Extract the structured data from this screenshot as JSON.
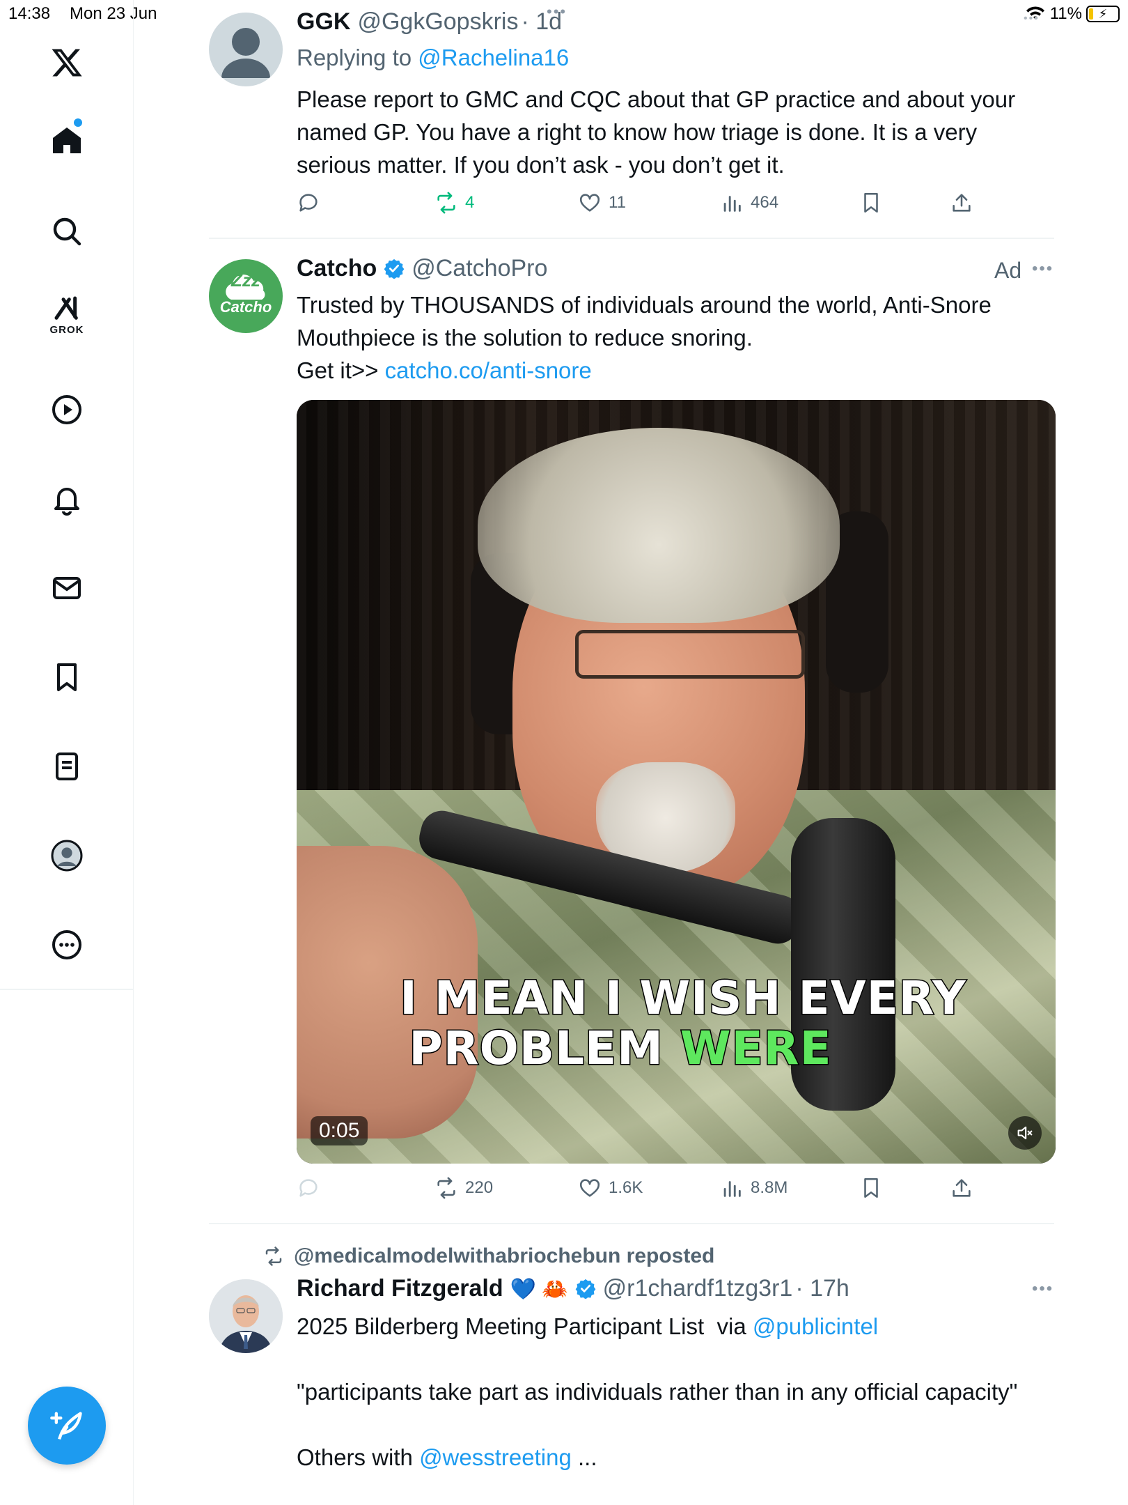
{
  "status_bar": {
    "time": "14:38",
    "date": "Mon 23 Jun",
    "battery": "11%"
  },
  "sidebar": {
    "items": [
      {
        "icon": "x-logo-icon"
      },
      {
        "icon": "home-icon",
        "has_notification_dot": true
      },
      {
        "icon": "search-icon"
      },
      {
        "icon": "grok-icon",
        "label": "GROK"
      },
      {
        "icon": "video-icon"
      },
      {
        "icon": "notifications-icon"
      },
      {
        "icon": "messages-icon"
      },
      {
        "icon": "bookmarks-icon"
      },
      {
        "icon": "lists-icon"
      },
      {
        "icon": "profile-icon"
      },
      {
        "icon": "more-icon"
      }
    ],
    "compose_icon": "compose-post-icon"
  },
  "tweets": [
    {
      "name": "GGK",
      "handle": "@GgkGopskris",
      "time": "· 1d",
      "replying_prefix": "Replying to ",
      "replying_to": "@Rachelina16",
      "text": "Please report to GMC and CQC about that GP practice and about your named GP. You have a right to know how triage is done. It is a very serious matter. If you don’t ask - you don’t get it.",
      "stats": {
        "replies": "",
        "reposts": "4",
        "likes": "11",
        "views": "464"
      },
      "reposted_by_me": true
    },
    {
      "name": "Catcho",
      "verified": true,
      "handle": "@CatchoPro",
      "ad_label": "Ad",
      "avatar_text_top": "Zzz",
      "avatar_text_bottom": "Catcho",
      "text_line1": "Trusted by THOUSANDS of individuals around the world, Anti-Snore Mouthpiece is the solution to reduce snoring.",
      "text_prefix": "Get it>> ",
      "link": "catcho.co/anti-snore",
      "video": {
        "caption_line1": "I MEAN I WISH EVERY",
        "caption_line2_white": "PROBLEM ",
        "caption_line2_green": "WERE",
        "timer": "0:05"
      },
      "stats": {
        "replies": "",
        "reposts": "220",
        "likes": "1.6K",
        "views": "8.8M"
      }
    },
    {
      "reposted_by": "@medicalmodelwithabriochebun reposted",
      "name": "Richard Fitzgerald",
      "name_emojis": "💙 🦀",
      "verified": true,
      "handle": "@r1chardf1tzg3r1",
      "time": "· 17h",
      "line1_text": "2025 Bilderberg Meeting Participant List  via ",
      "line1_link": "@publicintel",
      "quote": "\"participants take part as individuals rather than in any official capacity\"",
      "line3_text": "Others with ",
      "line3_link": "@wesstreeting",
      "line3_suffix": " ..."
    }
  ],
  "colors": {
    "accent": "#1d9bf0",
    "repost_green": "#00ba7c",
    "muted": "#536471",
    "text": "#0f1419",
    "catcho_green": "#48a85a"
  }
}
